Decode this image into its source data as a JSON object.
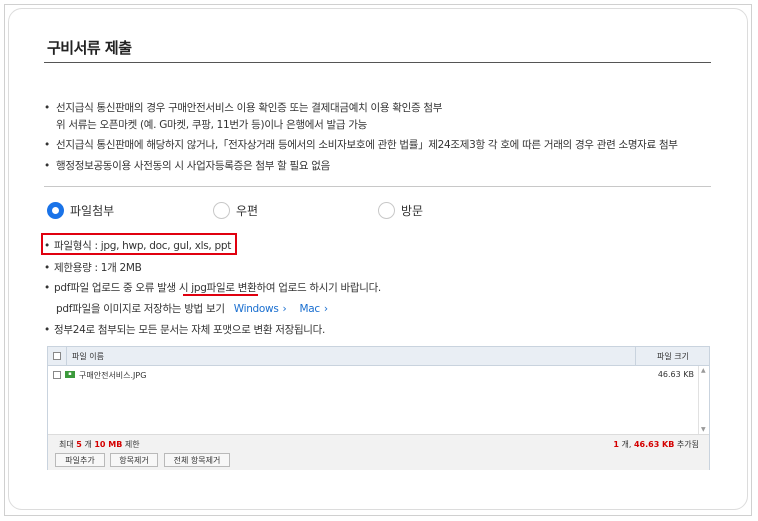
{
  "title": "구비서류 제출",
  "notes": {
    "n1_line1": "선지급식 통신판매의 경우 구매안전서비스 이용 확인증 또는 결제대금예치 이용 확인증 첨부",
    "n1_line2": "위 서류는 오픈마켓 (예. G마켓, 쿠팡, 11번가 등)이나 은행에서 발급 가능",
    "n2": "선지급식 통신판매에 해당하지 않거나,「전자상거래 등에서의 소비자보호에 관한 법률」제24조제3항 각 호에 따른 거래의 경우 관련 소명자료 첨부",
    "n3": "행정정보공동이용 사전동의 시 사업자등록증은 첨부 할 필요 없음"
  },
  "radios": [
    {
      "label": "파일첨부",
      "checked": true
    },
    {
      "label": "우편",
      "checked": false
    },
    {
      "label": "방문",
      "checked": false
    }
  ],
  "info": {
    "format": "파일형식 : jpg, hwp, doc, gul, xls, ppt",
    "limit": "제한용량 : 1개 2MB",
    "pdf_notice": "pdf파일 업로드 중 오류 발생 시 jpg파일로 변환하여 업로드 하시기 바랍니다.",
    "pdf_howto": "pdf파일을 이미지로 저장하는 방법 보기",
    "link_windows": "Windows",
    "link_mac": "Mac",
    "chevron": "›",
    "auto_convert": "정부24로 첨부되는 모든 문서는 자체 포맷으로 변환 저장됩니다."
  },
  "file_table": {
    "col_name": "파일 이름",
    "col_size": "파일 크기",
    "rows": [
      {
        "name": "구매안전서비스.JPG",
        "size": "46.63 KB",
        "icon": "jpg-file-icon"
      }
    ],
    "limit_prefix": "최대",
    "limit_count": "5",
    "limit_mid": "개",
    "limit_size": "10 MB",
    "limit_suffix": "제한",
    "total_count": "1",
    "total_mid": "개,",
    "total_size": "46.63 KB",
    "total_suffix": "추가됨"
  },
  "buttons": {
    "add": "파일추가",
    "remove": "항목제거",
    "remove_all": "전체 항목제거"
  },
  "colors": {
    "accent": "#1a73e8",
    "highlight": "#e0000f"
  }
}
